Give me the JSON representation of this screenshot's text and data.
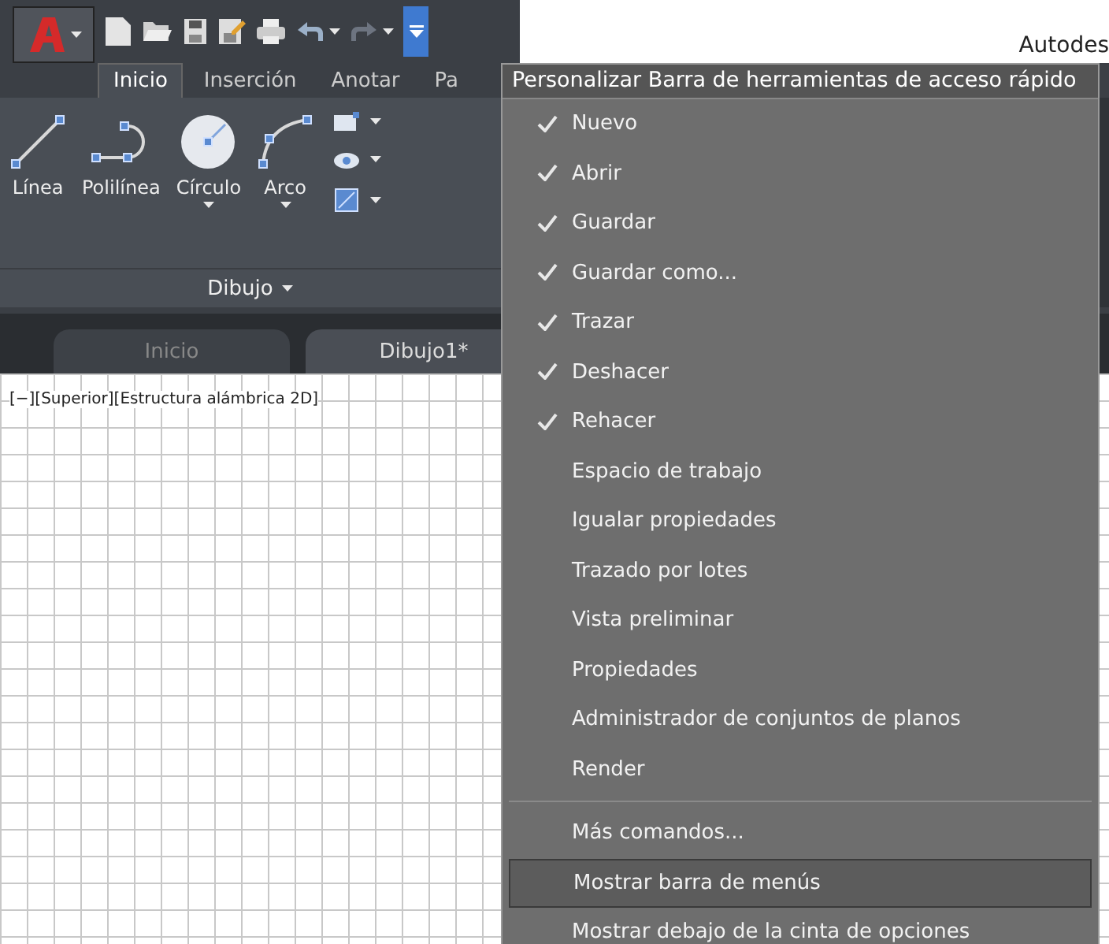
{
  "window": {
    "title": "Autodes"
  },
  "ribbon": {
    "tabs": [
      {
        "label": "Inicio",
        "selected": true
      },
      {
        "label": "Inserción",
        "selected": false
      },
      {
        "label": "Anotar",
        "selected": false
      },
      {
        "label": "Pa",
        "selected": false
      }
    ],
    "tools": [
      {
        "label": "Línea",
        "kind": "line",
        "dropdown": false
      },
      {
        "label": "Polilínea",
        "kind": "polyline",
        "dropdown": false
      },
      {
        "label": "Círculo",
        "kind": "circle",
        "dropdown": true
      },
      {
        "label": "Arco",
        "kind": "arc",
        "dropdown": true
      }
    ],
    "panel_label": "Dibujo"
  },
  "doc_tabs": [
    {
      "label": "Inicio",
      "selected": false
    },
    {
      "label": "Dibujo1*",
      "selected": true
    }
  ],
  "viewport_label": "[−][Superior][Estructura alámbrica 2D]",
  "menu": {
    "title": "Personalizar Barra de herramientas de acceso rápido",
    "groups": [
      [
        {
          "label": "Nuevo",
          "checked": true,
          "selected": false
        },
        {
          "label": "Abrir",
          "checked": true,
          "selected": false
        },
        {
          "label": "Guardar",
          "checked": true,
          "selected": false
        },
        {
          "label": "Guardar como...",
          "checked": true,
          "selected": false
        },
        {
          "label": "Trazar",
          "checked": true,
          "selected": false
        },
        {
          "label": "Deshacer",
          "checked": true,
          "selected": false
        },
        {
          "label": "Rehacer",
          "checked": true,
          "selected": false
        },
        {
          "label": "Espacio de trabajo",
          "checked": false,
          "selected": false
        },
        {
          "label": "Igualar propiedades",
          "checked": false,
          "selected": false
        },
        {
          "label": "Trazado por lotes",
          "checked": false,
          "selected": false
        },
        {
          "label": "Vista preliminar",
          "checked": false,
          "selected": false
        },
        {
          "label": "Propiedades",
          "checked": false,
          "selected": false
        },
        {
          "label": "Administrador de conjuntos de planos",
          "checked": false,
          "selected": false
        },
        {
          "label": "Render",
          "checked": false,
          "selected": false
        }
      ],
      [
        {
          "label": "Más comandos...",
          "checked": false,
          "selected": false
        },
        {
          "label": "Mostrar barra de menús",
          "checked": false,
          "selected": true
        },
        {
          "label": "Mostrar debajo de la cinta de opciones",
          "checked": false,
          "selected": false
        }
      ]
    ]
  }
}
